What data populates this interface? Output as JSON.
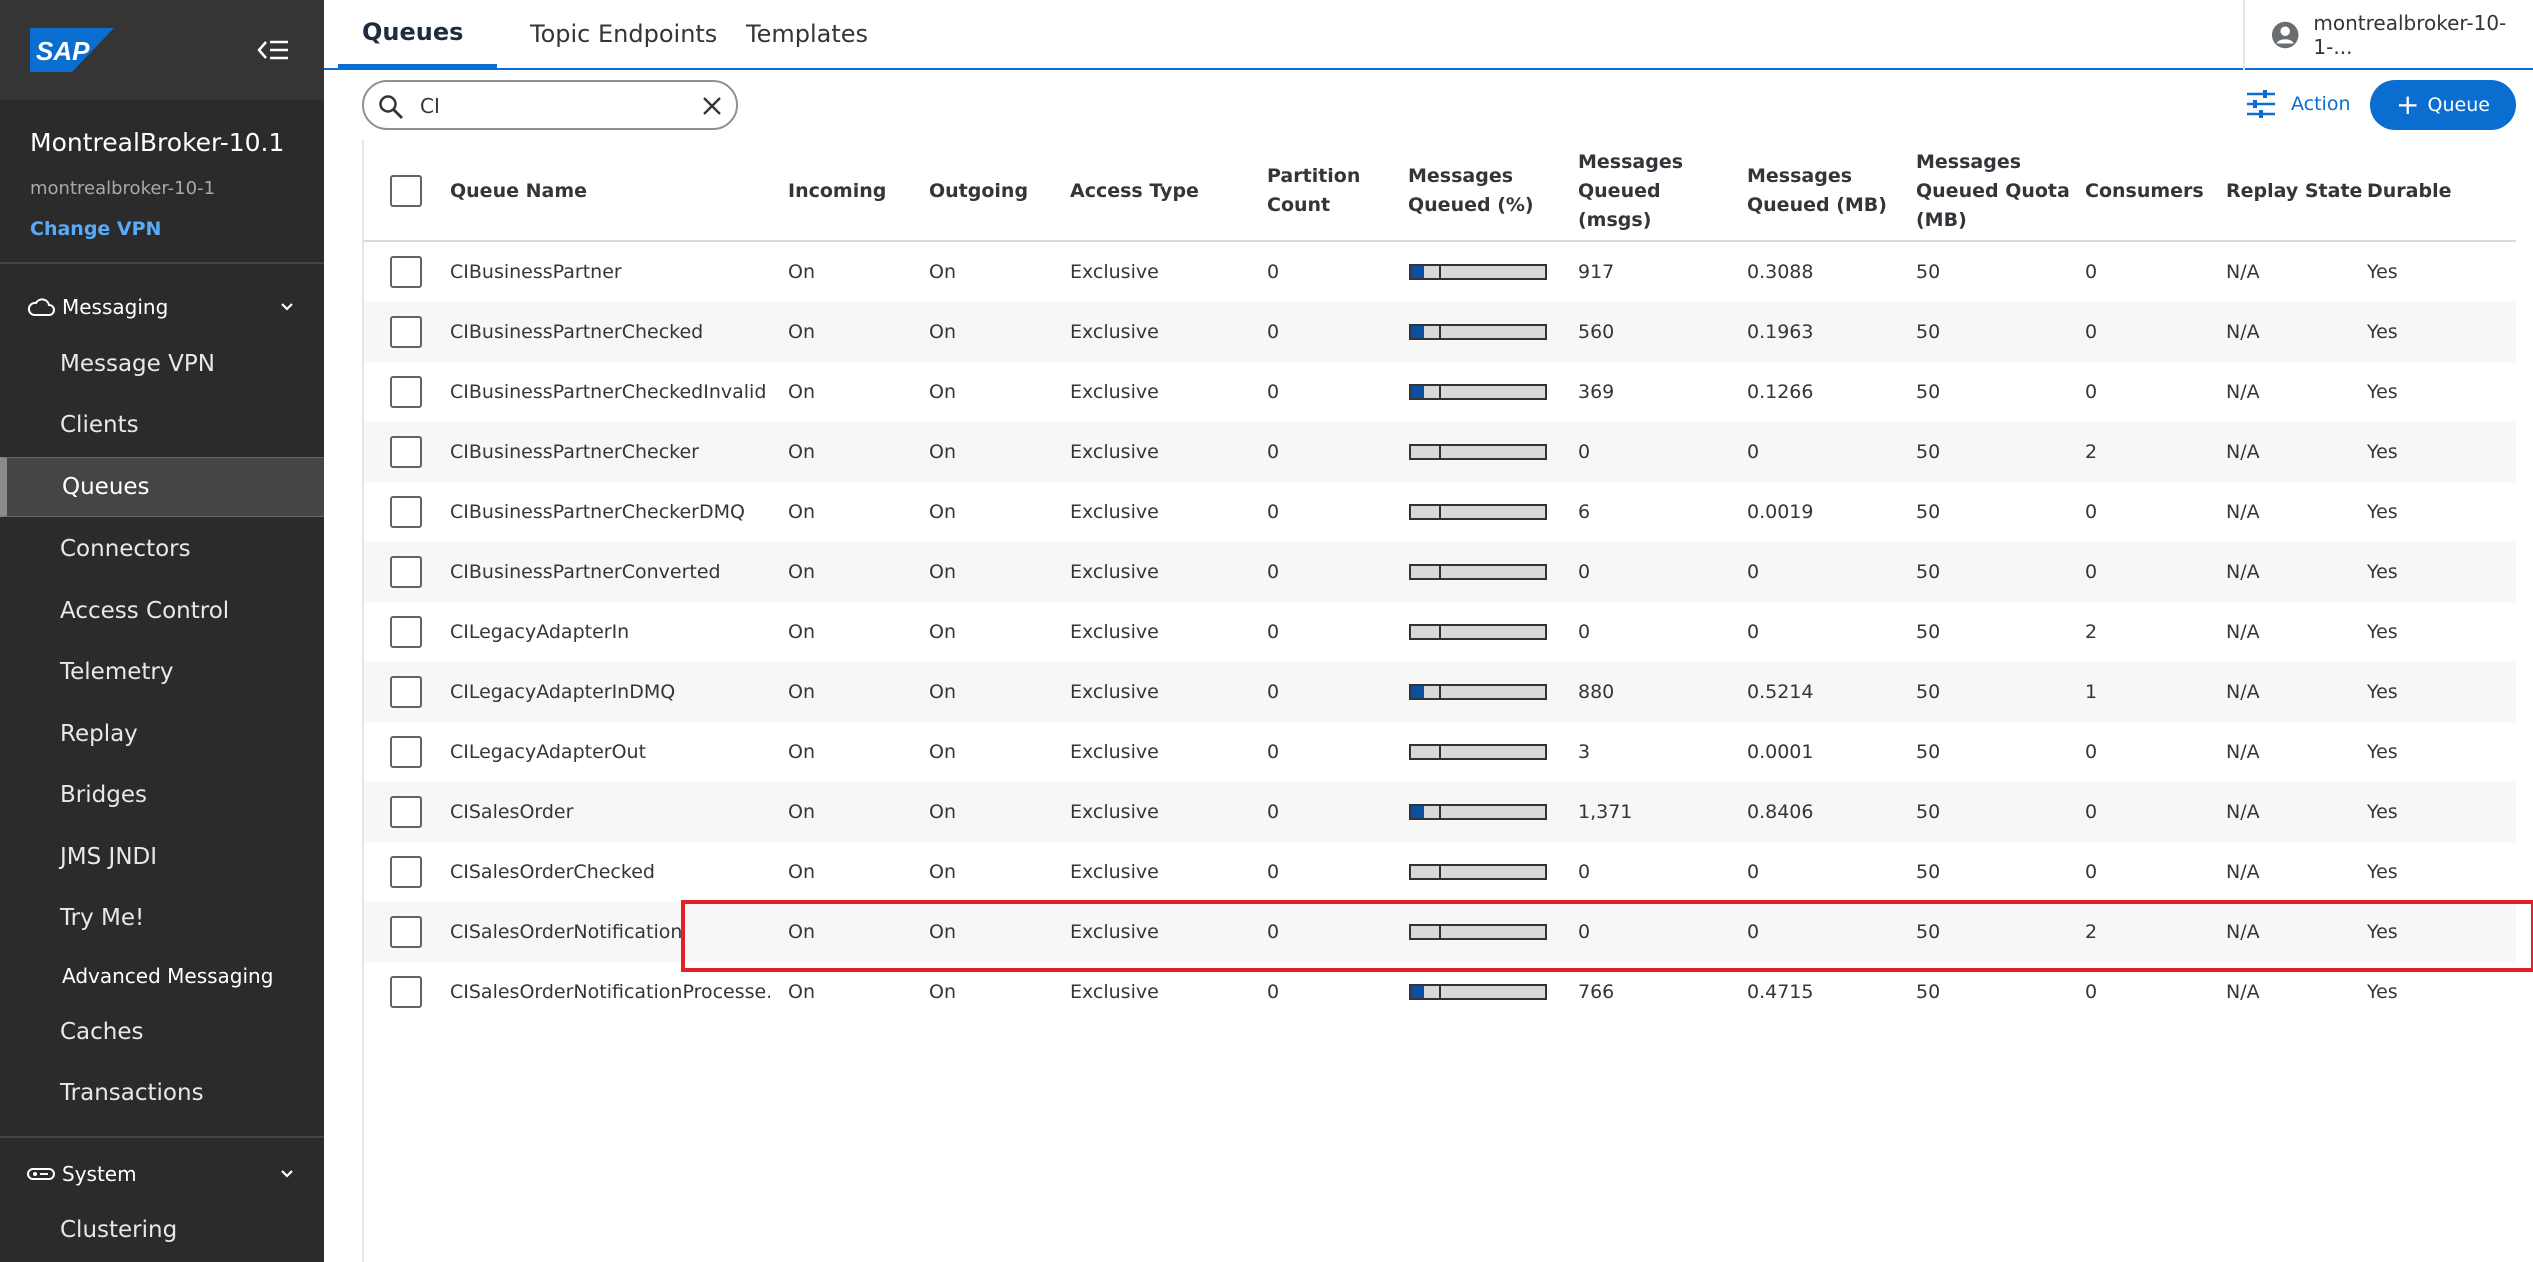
{
  "sidebar": {
    "logo_text": "SAP",
    "broker_title": "MontrealBroker-10.1",
    "broker_subtitle": "montrealbroker-10-1",
    "change_vpn": "Change VPN",
    "messaging_label": "Messaging",
    "system_label": "System",
    "items": [
      {
        "label": "Message VPN"
      },
      {
        "label": "Clients"
      },
      {
        "label": "Queues"
      },
      {
        "label": "Connectors"
      },
      {
        "label": "Access Control"
      },
      {
        "label": "Telemetry"
      },
      {
        "label": "Replay"
      },
      {
        "label": "Bridges"
      },
      {
        "label": "JMS JNDI"
      },
      {
        "label": "Try Me!"
      },
      {
        "label": "Advanced Messaging"
      },
      {
        "label": "Caches"
      },
      {
        "label": "Transactions"
      }
    ],
    "system_items": [
      {
        "label": "Clustering"
      }
    ]
  },
  "header": {
    "tabs": [
      {
        "label": "Queues"
      },
      {
        "label": "Topic Endpoints"
      },
      {
        "label": "Templates"
      }
    ],
    "user": "montrealbroker-10-1-..."
  },
  "toolbar": {
    "search_value": "CI",
    "action_label": "Action",
    "queue_label": "Queue"
  },
  "table": {
    "columns": {
      "name": "Queue Name",
      "incoming": "Incoming",
      "outgoing": "Outgoing",
      "access": "Access Type",
      "partition": "Partition Count",
      "pct": "Messages Queued (%)",
      "msgs": "Messages Queued (msgs)",
      "mb": "Messages Queued (MB)",
      "quota": "Messages Queued Quota (MB)",
      "consumers": "Consumers",
      "replay": "Replay State",
      "durable": "Durable"
    },
    "rows": [
      {
        "name": "CIBusinessPartner",
        "incoming": "On",
        "outgoing": "On",
        "access": "Exclusive",
        "partition": "0",
        "fill": 0.1,
        "msgs": "917",
        "mb": "0.3088",
        "quota": "50",
        "consumers": "0",
        "replay": "N/A",
        "durable": "Yes"
      },
      {
        "name": "CIBusinessPartnerChecked",
        "incoming": "On",
        "outgoing": "On",
        "access": "Exclusive",
        "partition": "0",
        "fill": 0.1,
        "msgs": "560",
        "mb": "0.1963",
        "quota": "50",
        "consumers": "0",
        "replay": "N/A",
        "durable": "Yes"
      },
      {
        "name": "CIBusinessPartnerCheckedInvalid",
        "incoming": "On",
        "outgoing": "On",
        "access": "Exclusive",
        "partition": "0",
        "fill": 0.1,
        "msgs": "369",
        "mb": "0.1266",
        "quota": "50",
        "consumers": "0",
        "replay": "N/A",
        "durable": "Yes"
      },
      {
        "name": "CIBusinessPartnerChecker",
        "incoming": "On",
        "outgoing": "On",
        "access": "Exclusive",
        "partition": "0",
        "fill": 0,
        "msgs": "0",
        "mb": "0",
        "quota": "50",
        "consumers": "2",
        "replay": "N/A",
        "durable": "Yes"
      },
      {
        "name": "CIBusinessPartnerCheckerDMQ",
        "incoming": "On",
        "outgoing": "On",
        "access": "Exclusive",
        "partition": "0",
        "fill": 0,
        "msgs": "6",
        "mb": "0.0019",
        "quota": "50",
        "consumers": "0",
        "replay": "N/A",
        "durable": "Yes"
      },
      {
        "name": "CIBusinessPartnerConverted",
        "incoming": "On",
        "outgoing": "On",
        "access": "Exclusive",
        "partition": "0",
        "fill": 0,
        "msgs": "0",
        "mb": "0",
        "quota": "50",
        "consumers": "0",
        "replay": "N/A",
        "durable": "Yes"
      },
      {
        "name": "CILegacyAdapterIn",
        "incoming": "On",
        "outgoing": "On",
        "access": "Exclusive",
        "partition": "0",
        "fill": 0,
        "msgs": "0",
        "mb": "0",
        "quota": "50",
        "consumers": "2",
        "replay": "N/A",
        "durable": "Yes"
      },
      {
        "name": "CILegacyAdapterInDMQ",
        "incoming": "On",
        "outgoing": "On",
        "access": "Exclusive",
        "partition": "0",
        "fill": 0.1,
        "msgs": "880",
        "mb": "0.5214",
        "quota": "50",
        "consumers": "1",
        "replay": "N/A",
        "durable": "Yes"
      },
      {
        "name": "CILegacyAdapterOut",
        "incoming": "On",
        "outgoing": "On",
        "access": "Exclusive",
        "partition": "0",
        "fill": 0,
        "msgs": "3",
        "mb": "0.0001",
        "quota": "50",
        "consumers": "0",
        "replay": "N/A",
        "durable": "Yes"
      },
      {
        "name": "CISalesOrder",
        "incoming": "On",
        "outgoing": "On",
        "access": "Exclusive",
        "partition": "0",
        "fill": 0.1,
        "msgs": "1,371",
        "mb": "0.8406",
        "quota": "50",
        "consumers": "0",
        "replay": "N/A",
        "durable": "Yes"
      },
      {
        "name": "CISalesOrderChecked",
        "incoming": "On",
        "outgoing": "On",
        "access": "Exclusive",
        "partition": "0",
        "fill": 0,
        "msgs": "0",
        "mb": "0",
        "quota": "50",
        "consumers": "0",
        "replay": "N/A",
        "durable": "Yes"
      },
      {
        "name": "CISalesOrderNotification",
        "incoming": "On",
        "outgoing": "On",
        "access": "Exclusive",
        "partition": "0",
        "fill": 0,
        "msgs": "0",
        "mb": "0",
        "quota": "50",
        "consumers": "2",
        "replay": "N/A",
        "durable": "Yes"
      },
      {
        "name": "CISalesOrderNotificationProcesse...",
        "incoming": "On",
        "outgoing": "On",
        "access": "Exclusive",
        "partition": "0",
        "fill": 0.1,
        "msgs": "766",
        "mb": "0.4715",
        "quota": "50",
        "consumers": "0",
        "replay": "N/A",
        "durable": "Yes"
      }
    ]
  },
  "colors": {
    "sidebar_bg": "#2b2b2b",
    "accent": "#0a6ed1",
    "link": "#5aaafa",
    "bar_fill": "#0b4fa0",
    "highlight": "#e0202a"
  }
}
